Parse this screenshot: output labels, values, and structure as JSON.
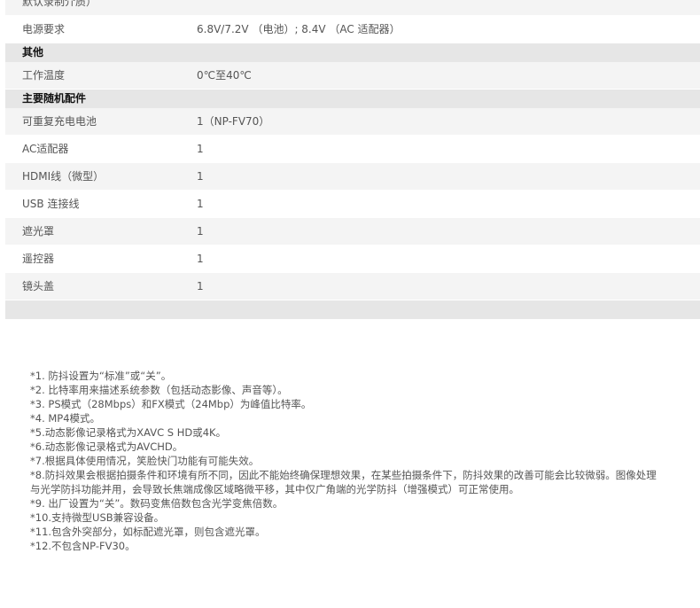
{
  "specs": {
    "partial_row": {
      "label": "默认录制介质）"
    },
    "power_row": {
      "label": "电源要求",
      "value": "6.8V/7.2V （电池）; 8.4V （AC 适配器）"
    },
    "section_other": {
      "title": "其他"
    },
    "temp_row": {
      "label": "工作温度",
      "value": "0℃至40℃"
    },
    "section_accessories": {
      "title": "主要随机配件"
    },
    "accessories": [
      {
        "label": "可重复充电电池",
        "value": "1（NP-FV70）"
      },
      {
        "label": "AC适配器",
        "value": "1"
      },
      {
        "label": "HDMI线（微型）",
        "value": "1"
      },
      {
        "label": "USB 连接线",
        "value": "1"
      },
      {
        "label": "遮光罩",
        "value": "1"
      },
      {
        "label": "遥控器",
        "value": "1"
      },
      {
        "label": "镜头盖",
        "value": "1"
      }
    ]
  },
  "notes": [
    "*1. 防抖设置为“标准”或“关”。",
    "*2. 比特率用来描述系统参数（包括动态影像、声音等）。",
    "*3. PS模式（28Mbps）和FX模式（24Mbp）为峰值比特率。",
    "*4. MP4模式。",
    "*5.动态影像记录格式为XAVC S HD或4K。",
    "*6.动态影像记录格式为AVCHD。",
    "*7.根据具体使用情况，笑脸快门功能有可能失效。",
    "*8.防抖效果会根据拍摄条件和环境有所不同，因此不能始终确保理想效果，在某些拍摄条件下，防抖效果的改善可能会比较微弱。图像处理与光学防抖功能并用，会导致长焦端成像区域略微平移，其中仅广角端的光学防抖（增强模式）可正常使用。",
    "*9. 出厂设置为“关”。数码变焦倍数包含光学变焦倍数。",
    "*10.支持微型USB兼容设备。",
    "*11.包含外突部分，如标配遮光罩，则包含遮光罩。",
    "*12.不包含NP-FV30。"
  ]
}
